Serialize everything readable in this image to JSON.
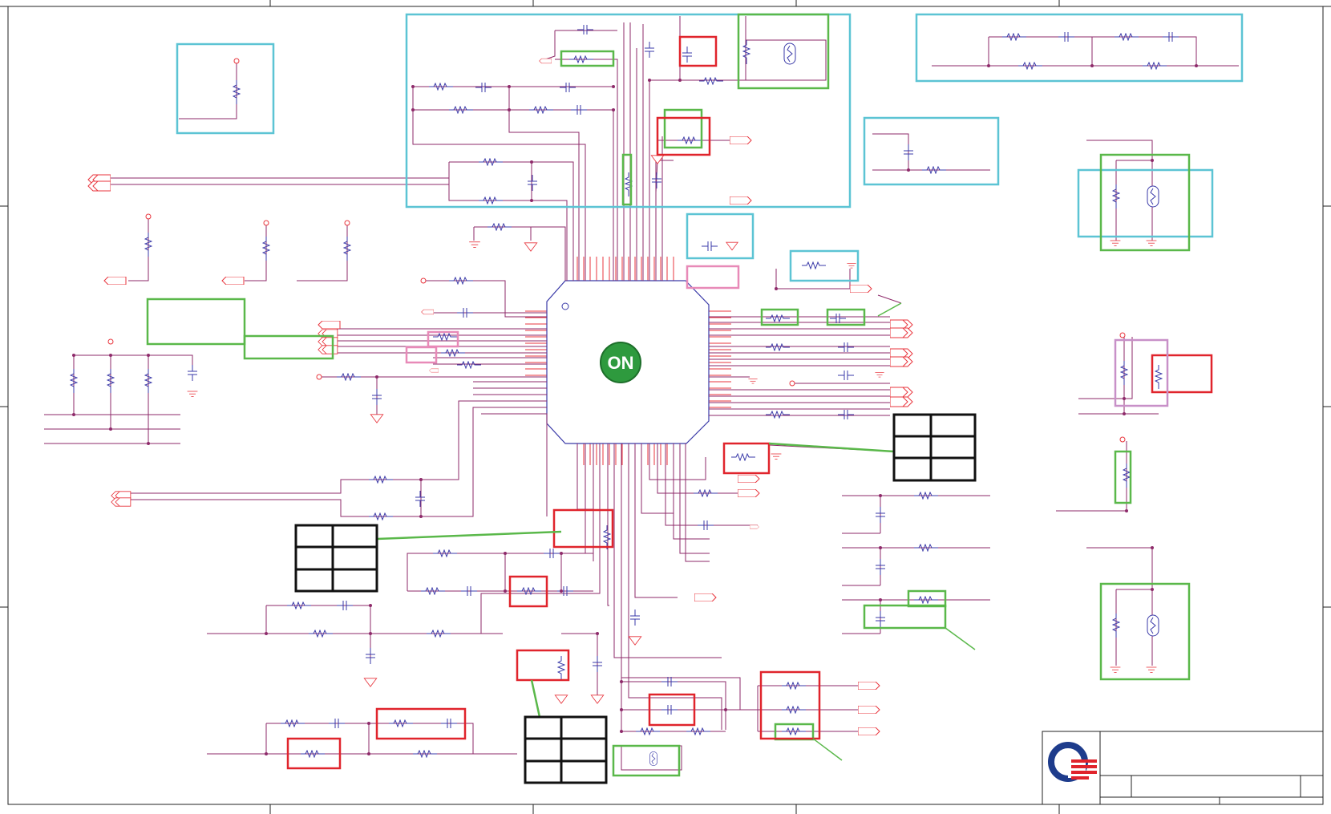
{
  "ic": {
    "logo_text": "ON"
  },
  "colors": {
    "wire": "#e8343c",
    "net": "#8e2a6a",
    "component": "#3a3aa8",
    "highlight_blue": "#5cc4d4",
    "highlight_green": "#5ab84a",
    "highlight_red": "#e0242c",
    "highlight_pink": "#e88ab8",
    "logo_green": "#2e9a3e",
    "company_logo_blue": "#1e3c8c",
    "company_logo_red": "#e0242c"
  },
  "icons": {
    "chip_logo": "on-semiconductor-logo-icon",
    "company_logo": "company-logo-icon"
  }
}
